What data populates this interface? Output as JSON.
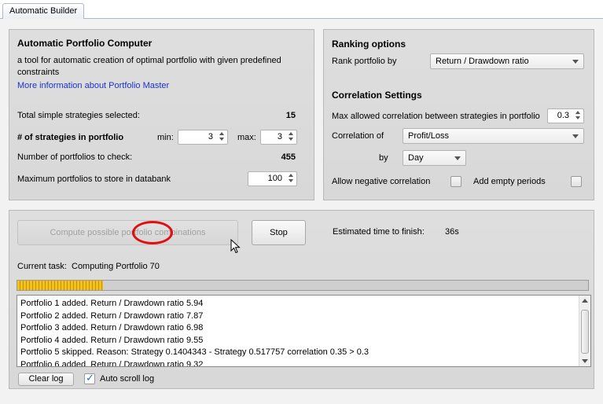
{
  "tab": {
    "label": "Automatic Builder"
  },
  "computer": {
    "title": "Automatic Portfolio Computer",
    "description_line1": "a tool for automatic creation of optimal portfolio with given predefined",
    "description_line2": "constraints",
    "more_info_link": "More information about Portfolio Master",
    "total_label": "Total simple strategies selected:",
    "total_value": "15",
    "strategies_label": "# of strategies in portfolio",
    "min_label": "min:",
    "min_value": "3",
    "max_label": "max:",
    "max_value": "3",
    "check_label": "Number of portfolios to check:",
    "check_value": "455",
    "store_label": "Maximum portfolios to store in databank",
    "store_value": "100"
  },
  "ranking": {
    "title": "Ranking options",
    "rank_label": "Rank portfolio by",
    "rank_value": "Return / Drawdown ratio"
  },
  "correlation": {
    "title": "Correlation Settings",
    "max_label": "Max allowed correlation between strategies in portfolio",
    "max_value": "0.3",
    "of_label": "Correlation of",
    "of_value": "Profit/Loss",
    "by_label": "by",
    "by_value": "Day",
    "negative_label": "Allow negative correlation",
    "negative_checked": false,
    "empty_label": "Add empty periods",
    "empty_checked": false
  },
  "run": {
    "compute_button": "Compute possible portfolio combinations",
    "stop_button": "Stop",
    "eta_label": "Estimated time to finish:",
    "eta_value": "36s",
    "task_label": "Current task:",
    "task_value": "Computing Portfolio 70",
    "progress": 0.15,
    "log": [
      "Portfolio 1 added. Return / Drawdown ratio 5.94",
      "Portfolio 2 added. Return / Drawdown ratio 7.87",
      "Portfolio 3 added. Return / Drawdown ratio 6.98",
      "Portfolio 4 added. Return / Drawdown ratio 9.55",
      "Portfolio 5 skipped. Reason: Strategy 0.1404343 - Strategy 0.517757 correlation 0.35 > 0.3",
      "Portfolio 6 added. Return / Drawdown ratio 9.32"
    ],
    "clear_log_button": "Clear log",
    "auto_scroll_label": "Auto scroll log",
    "auto_scroll_checked": true
  },
  "colors": {
    "annotation_circle": "#e01010",
    "progress_fill": "#f3c21a",
    "link": "#1a33cc"
  }
}
